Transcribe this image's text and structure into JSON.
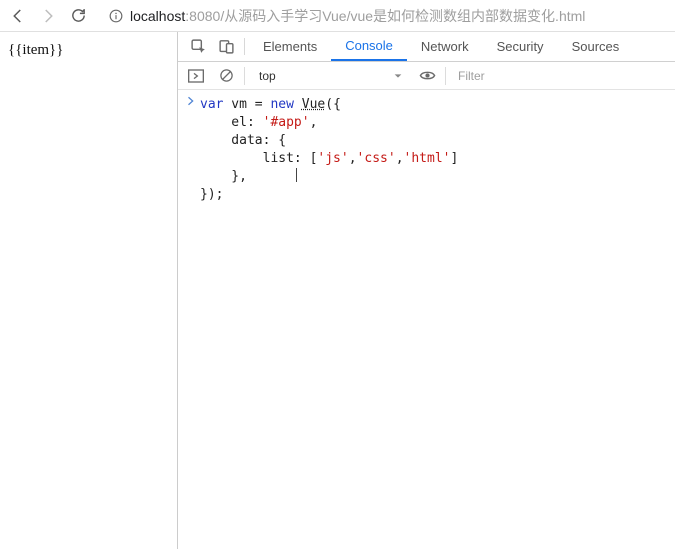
{
  "browser": {
    "url_host": "localhost",
    "url_port": ":8080",
    "url_path": "/从源码入手学习Vue/vue是如何检测数组内部数据变化.html"
  },
  "page": {
    "body_text": "{{item}}"
  },
  "devtools": {
    "tabs": {
      "elements": "Elements",
      "console": "Console",
      "network": "Network",
      "security": "Security",
      "sources": "Sources"
    },
    "toolbar": {
      "context": "top",
      "filter_placeholder": "Filter"
    },
    "console": {
      "code": {
        "l1a": "var",
        "l1b": " vm = ",
        "l1c": "new",
        "l1d": " ",
        "l1e": "Vue",
        "l1f": "({",
        "l2a": "    el: ",
        "l2b": "'#app'",
        "l2c": ",",
        "l3": "    data: {",
        "l4a": "        list: [",
        "l4b": "'js'",
        "l4c": ",",
        "l4d": "'css'",
        "l4e": ",",
        "l4f": "'html'",
        "l4g": "]",
        "l5": "    },",
        "l6": "});"
      }
    }
  }
}
